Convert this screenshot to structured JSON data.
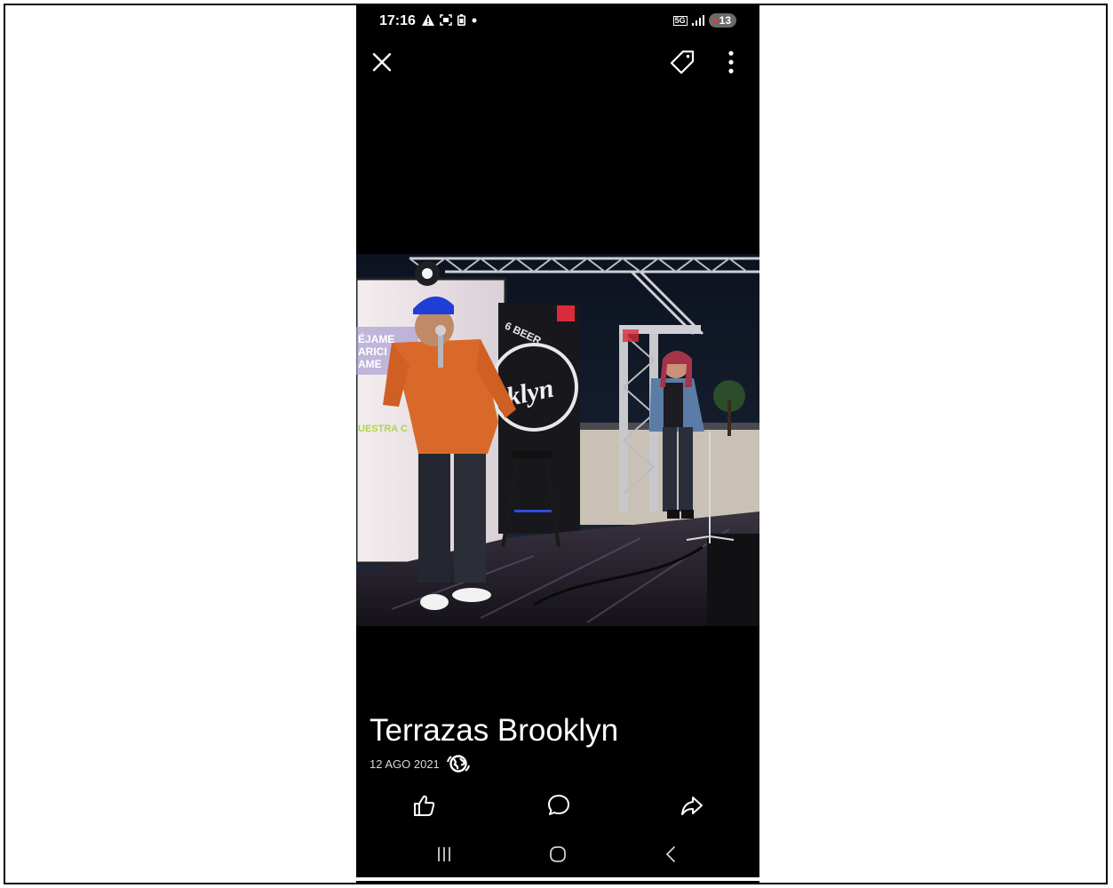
{
  "status_bar": {
    "time": "17:16",
    "left_icons": [
      "warning-icon",
      "screenshot-icon",
      "battery-saver-icon",
      "dot-icon"
    ],
    "network": "5G",
    "battery_level": "13"
  },
  "toolbar": {
    "icons": [
      "close-icon",
      "tag-icon",
      "more-vertical-icon"
    ]
  },
  "photo": {
    "screen_text": [
      "ÉJAME",
      "ARICI",
      "AME",
      "UESTRA C"
    ],
    "sign_text_top": "6 BEER",
    "sign_text_main": "klyn"
  },
  "caption": {
    "title": "Terrazas Brooklyn",
    "date": "12 AGO 2021",
    "privacy_icon": "globe-icon"
  },
  "actions": {
    "icons": [
      "like-icon",
      "comment-icon",
      "share-icon"
    ]
  },
  "navigation": {
    "icons": [
      "recents-icon",
      "home-icon",
      "back-icon"
    ]
  },
  "colors": {
    "background": "#000000",
    "text": "#ffffff",
    "battery_badge": "#6b6b6b",
    "battery_dot": "#e53935"
  }
}
